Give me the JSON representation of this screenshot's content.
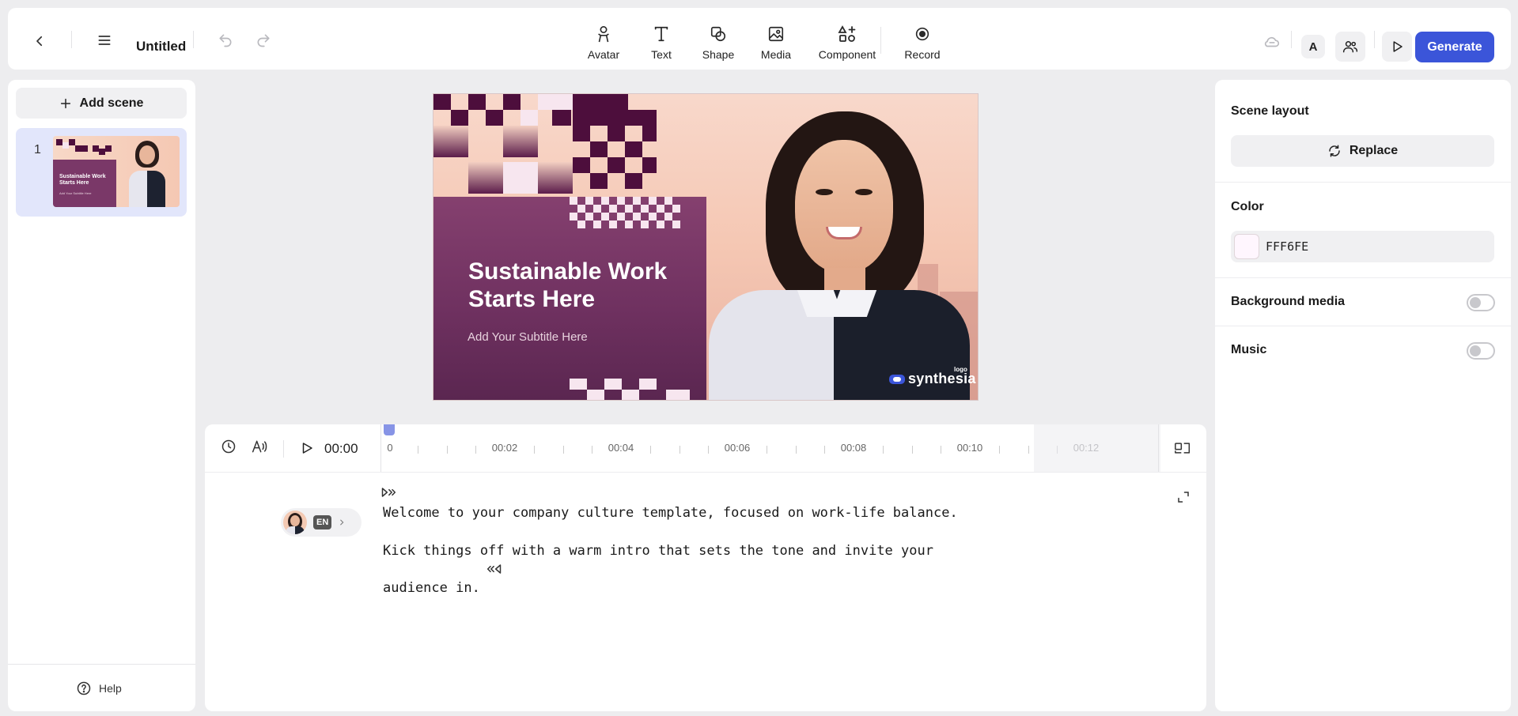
{
  "topbar": {
    "title": "Untitled",
    "tools": [
      {
        "label": "Avatar",
        "icon": "avatar-icon"
      },
      {
        "label": "Text",
        "icon": "text-icon"
      },
      {
        "label": "Shape",
        "icon": "shape-icon"
      },
      {
        "label": "Media",
        "icon": "media-icon"
      },
      {
        "label": "Component",
        "icon": "component-icon"
      },
      {
        "label": "Record",
        "icon": "record-icon"
      }
    ],
    "font_button_label": "A",
    "generate_label": "Generate",
    "accent_color": "#3b55d9"
  },
  "left_panel": {
    "add_scene_label": "Add scene",
    "scenes": [
      {
        "number": "1",
        "thumb_title": "Sustainable Work Starts Here",
        "thumb_subtitle": "Add Your Subtitle Here"
      }
    ],
    "help_label": "Help"
  },
  "slide": {
    "title": "Sustainable Work Starts Here",
    "subtitle": "Add Your Subtitle Here",
    "logo_text": "synthesia",
    "logo_tag": "logo"
  },
  "timeline": {
    "current_time": "00:00",
    "ticks": [
      "0",
      "00:02",
      "00:04",
      "00:06",
      "00:08",
      "00:10",
      "00:12"
    ]
  },
  "script": {
    "avatar_language": "EN",
    "lines": [
      "Welcome to your company culture template, focused on work-life balance.",
      "Kick things off with a warm intro that sets the tone and invite your",
      "audience in."
    ]
  },
  "right_panel": {
    "scene_layout_label": "Scene layout",
    "replace_label": "Replace",
    "color_label": "Color",
    "color_value": "FFF6FE",
    "color_hex": "#FFF6FE",
    "background_media_label": "Background media",
    "background_media_on": false,
    "music_label": "Music",
    "music_on": false
  }
}
